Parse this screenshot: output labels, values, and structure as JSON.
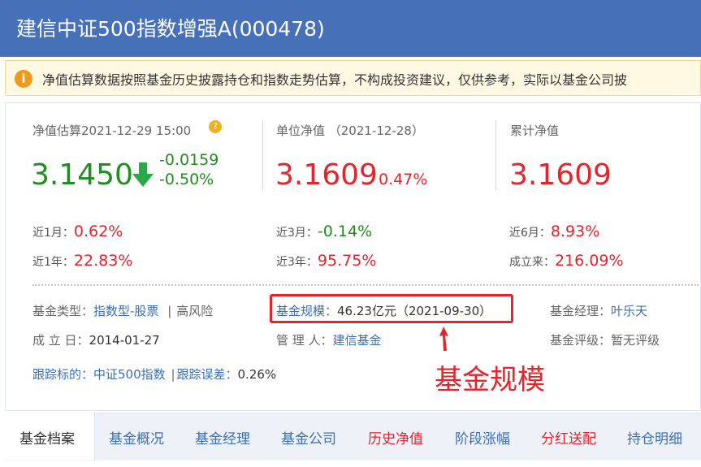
{
  "header": {
    "title": "建信中证500指数增强A(000478)"
  },
  "notice": {
    "text": "净值估算数据按照基金历史披露持仓和指数走势估算，不构成投资建议，仅供参考，实际以基金公司披"
  },
  "estimate": {
    "label": "净值估算2021-12-29 15:00",
    "value": "3.1450",
    "change_abs": "-0.0159",
    "change_pct": "-0.50%"
  },
  "unit_nav": {
    "label": "单位净值 （2021-12-28）",
    "value": "3.1609",
    "change_pct": "0.47%"
  },
  "cum_nav": {
    "label": "累计净值",
    "value": "3.1609"
  },
  "returns": [
    {
      "label": "近1月：",
      "value": "0.62%",
      "color": "#e8232a"
    },
    {
      "label": "近1年：",
      "value": "22.83%",
      "color": "#e8232a"
    },
    {
      "label": "近3月：",
      "value": "-0.14%",
      "color": "#1f8f1f"
    },
    {
      "label": "近3年：",
      "value": "95.75%",
      "color": "#e8232a"
    },
    {
      "label": "近6月：",
      "value": "8.93%",
      "color": "#e8232a"
    },
    {
      "label": "成立来：",
      "value": "216.09%",
      "color": "#e8232a"
    }
  ],
  "info": {
    "type_label": "基金类型：",
    "type_value": "指数型-股票",
    "type_sep": "|",
    "risk": "高风险",
    "scale_label": "基金规模：",
    "scale_value": "46.23亿元（2021-09-30）",
    "manager_label": "基金经理：",
    "manager_value": "叶乐天",
    "found_label": "成 立 日：",
    "found_value": "2014-01-27",
    "admin_label": "管 理 人：",
    "admin_value": "建信基金",
    "rating_label": "基金评级：",
    "rating_value": "暂无评级",
    "track_label": "跟踪标的：",
    "track_value": "中证500指数",
    "track_sep": "|",
    "error_label": "跟踪误差：",
    "error_value": "0.26%"
  },
  "annotation": {
    "text": "基金规模"
  },
  "tabs": [
    "基金档案",
    "基金概况",
    "基金经理",
    "基金公司",
    "历史净值",
    "阶段涨幅",
    "分红送配",
    "持仓明细"
  ],
  "colors": {
    "header_bg": "#4670b8",
    "up": "#e8232a",
    "down": "#1f8f1f",
    "link": "#3a6fb5"
  }
}
